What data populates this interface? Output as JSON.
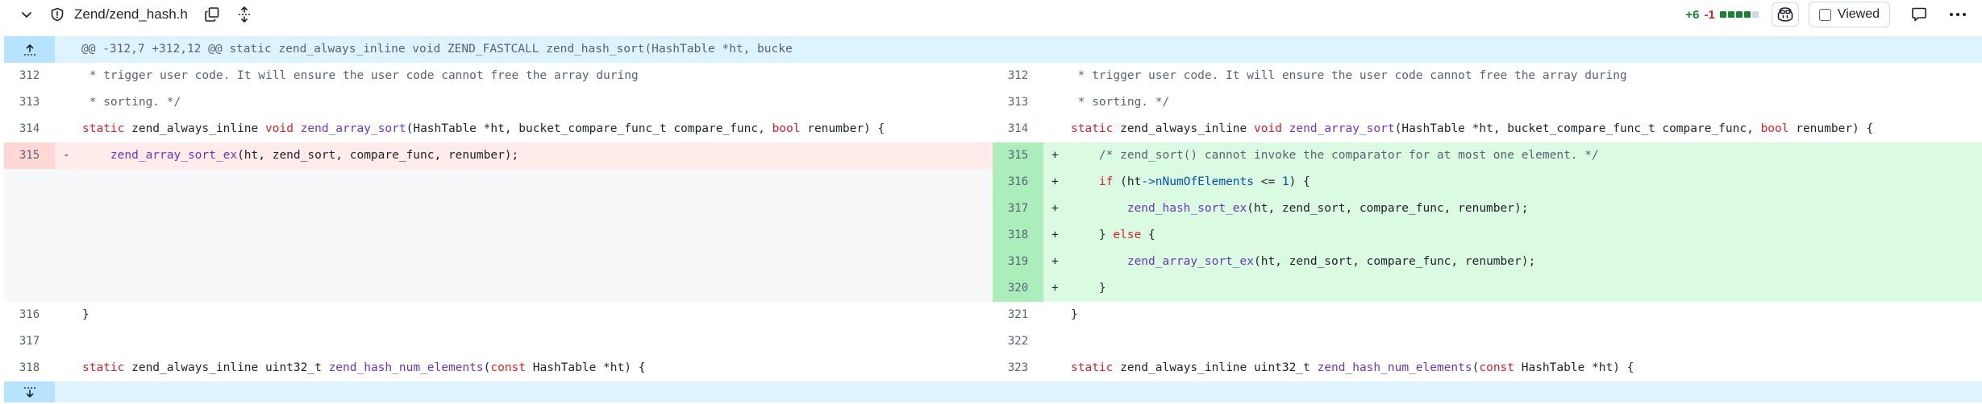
{
  "file": {
    "path": "Zend/zend_hash.h",
    "additions": "+6",
    "deletions": "-1",
    "diffstat_blocks": [
      "#1a7f37",
      "#1a7f37",
      "#1a7f37",
      "#1a7f37",
      "#d0d7de"
    ],
    "viewed_label": "Viewed"
  },
  "hunk_header": "@@ -312,7 +312,12 @@ static zend_always_inline void ZEND_FASTCALL zend_hash_sort(HashTable *ht, bucke",
  "rows": [
    {
      "left_num": "312",
      "left_text": " * trigger user code. It will ensure the user code cannot free the array during",
      "right_num": "312",
      "right_text": " * trigger user code. It will ensure the user code cannot free the array during"
    },
    {
      "left_num": "313",
      "left_text": " * sorting. */",
      "right_num": "313",
      "right_text": " * sorting. */"
    },
    {
      "left_num": "314",
      "left_text": "static zend_always_inline void zend_array_sort(HashTable *ht, bucket_compare_func_t compare_func, bool renumber) {",
      "right_num": "314",
      "right_text": "static zend_always_inline void zend_array_sort(HashTable *ht, bucket_compare_func_t compare_func, bool renumber) {"
    },
    {
      "left_num": "315",
      "left_marker": "-",
      "left_text": "    zend_array_sort_ex(ht, zend_sort, compare_func, renumber);",
      "right_num": "315",
      "right_marker": "+",
      "right_text": "    /* zend_sort() cannot invoke the comparator for at most one element. */"
    },
    {
      "right_num": "316",
      "right_marker": "+",
      "right_text": "    if (ht->nNumOfElements <= 1) {"
    },
    {
      "right_num": "317",
      "right_marker": "+",
      "right_text": "        zend_hash_sort_ex(ht, zend_sort, compare_func, renumber);"
    },
    {
      "right_num": "318",
      "right_marker": "+",
      "right_text": "    } else {"
    },
    {
      "right_num": "319",
      "right_marker": "+",
      "right_text": "        zend_array_sort_ex(ht, zend_sort, compare_func, renumber);"
    },
    {
      "right_num": "320",
      "right_marker": "+",
      "right_text": "    }"
    },
    {
      "left_num": "316",
      "left_text": "}",
      "right_num": "321",
      "right_text": "}"
    },
    {
      "left_num": "317",
      "left_text": "",
      "right_num": "322",
      "right_text": ""
    },
    {
      "left_num": "318",
      "left_text": "static zend_always_inline uint32_t zend_hash_num_elements(const HashTable *ht) {",
      "right_num": "323",
      "right_text": "static zend_always_inline uint32_t zend_hash_num_elements(const HashTable *ht) {"
    }
  ],
  "icons": [
    "chevron-down-icon",
    "shield-icon",
    "copy-icon",
    "expand-all-icon",
    "copilot-icon",
    "comment-icon",
    "kebab-icon",
    "expand-up-icon",
    "expand-down-icon"
  ]
}
